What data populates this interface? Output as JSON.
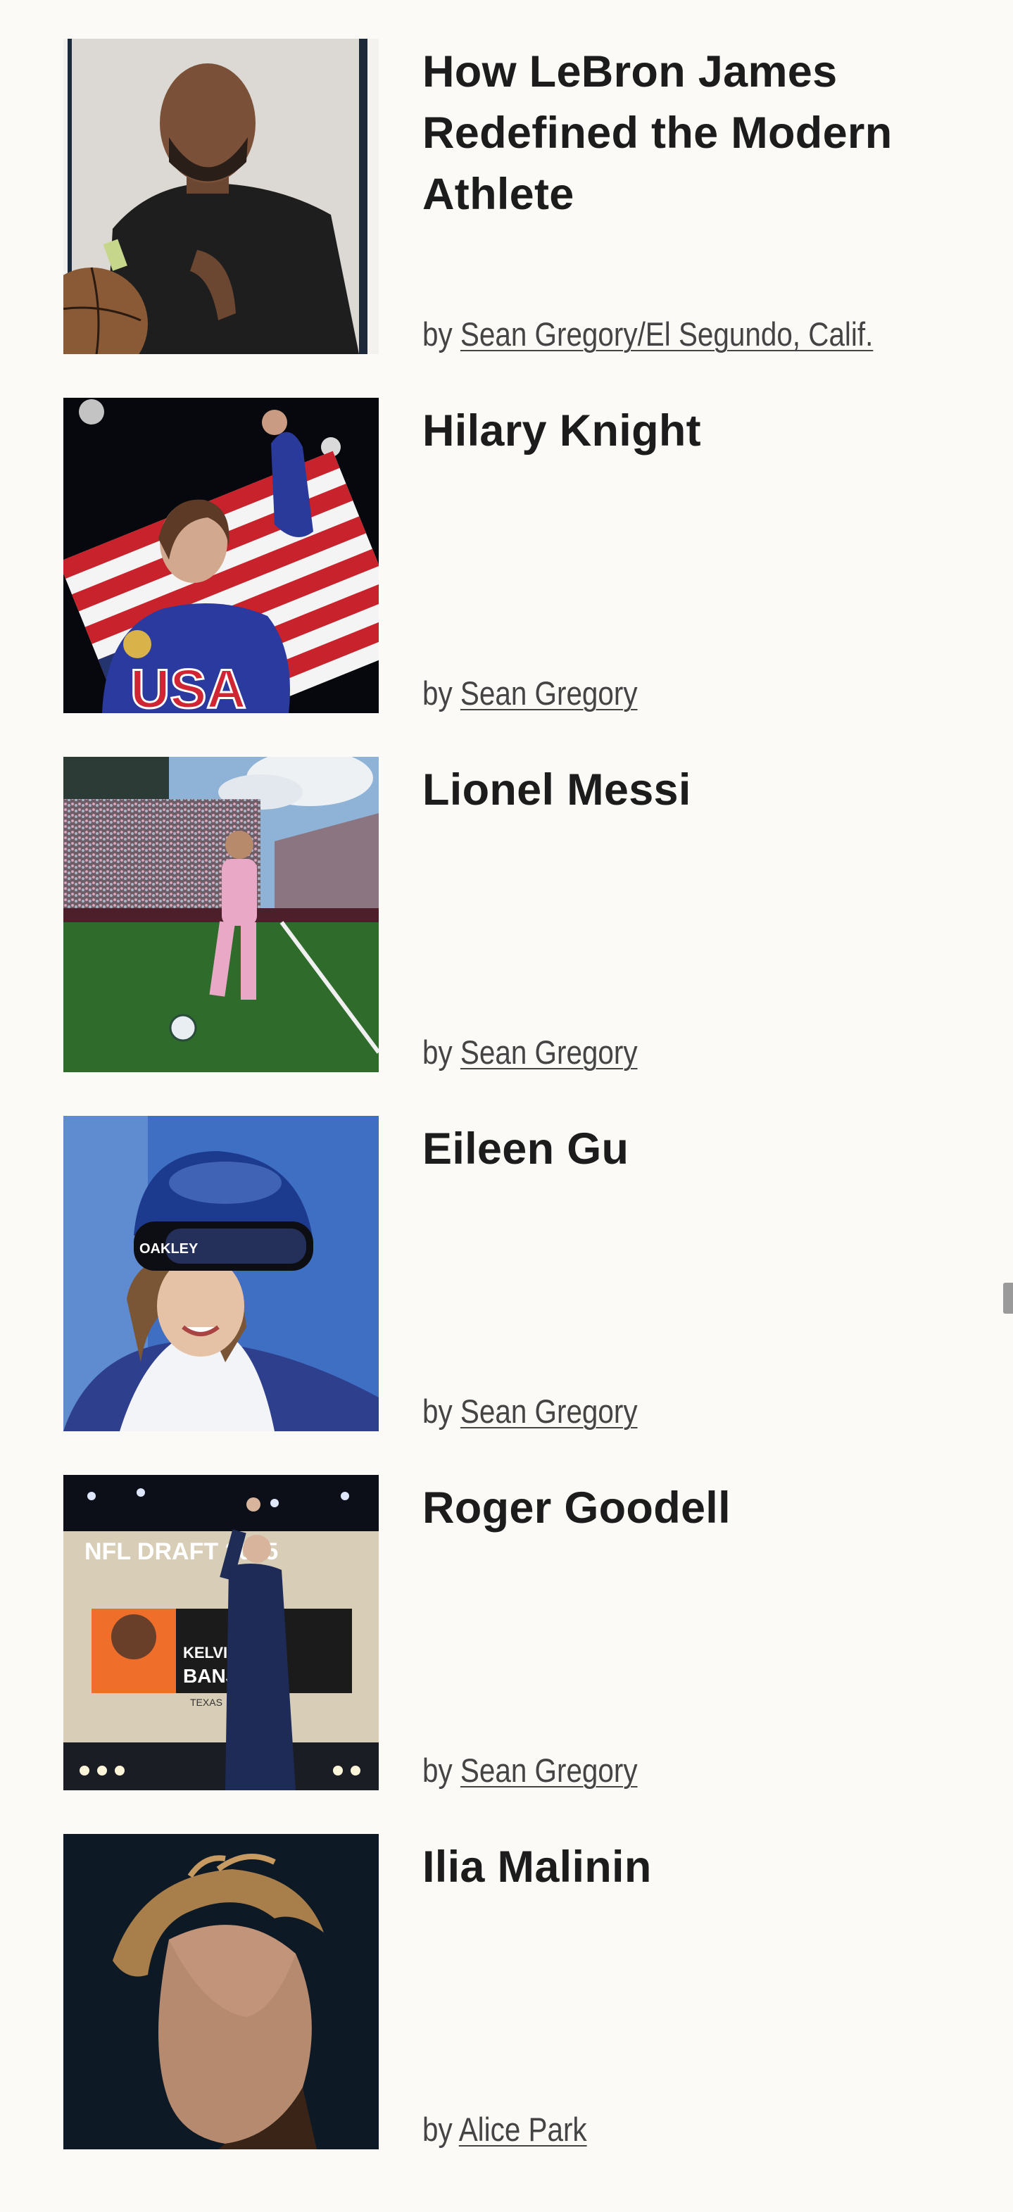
{
  "by_prefix": "by",
  "articles": [
    {
      "title": "How LeBron James Redefined the Modern Athlete",
      "author": "Sean Gregory/El Segundo, Calif."
    },
    {
      "title": "Hilary Knight",
      "author": "Sean Gregory"
    },
    {
      "title": "Lionel Messi",
      "author": "Sean Gregory"
    },
    {
      "title": "Eileen Gu",
      "author": "Sean Gregory"
    },
    {
      "title": "Roger Goodell",
      "author": "Sean Gregory"
    },
    {
      "title": "Ilia Malinin",
      "author": "Alice Park"
    }
  ],
  "image_text": {
    "usa_jersey": "USA",
    "draft_banner": "NFL DRAFT 2025",
    "draft_screen_name_1": "KELVIN",
    "draft_screen_name_2": "BANJAMIN",
    "draft_screen_team": "TEXAS",
    "goggle_brand": "OAKLEY"
  }
}
